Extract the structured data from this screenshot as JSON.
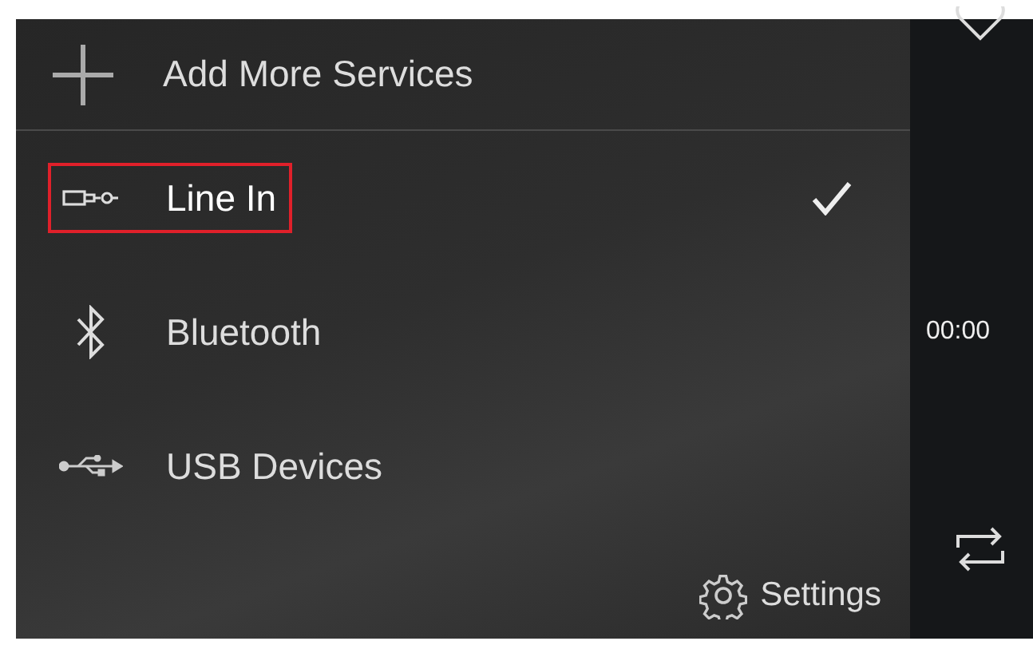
{
  "menu": {
    "add_item": {
      "label": "Add More Services"
    },
    "sources": [
      {
        "kind": "line-in",
        "label": "Line In",
        "selected": true,
        "highlighted": true
      },
      {
        "kind": "bluetooth",
        "label": "Bluetooth",
        "selected": false,
        "highlighted": false
      },
      {
        "kind": "usb",
        "label": "USB Devices",
        "selected": false,
        "highlighted": false
      }
    ],
    "settings": {
      "label": "Settings"
    }
  },
  "player": {
    "time": "00:00"
  }
}
